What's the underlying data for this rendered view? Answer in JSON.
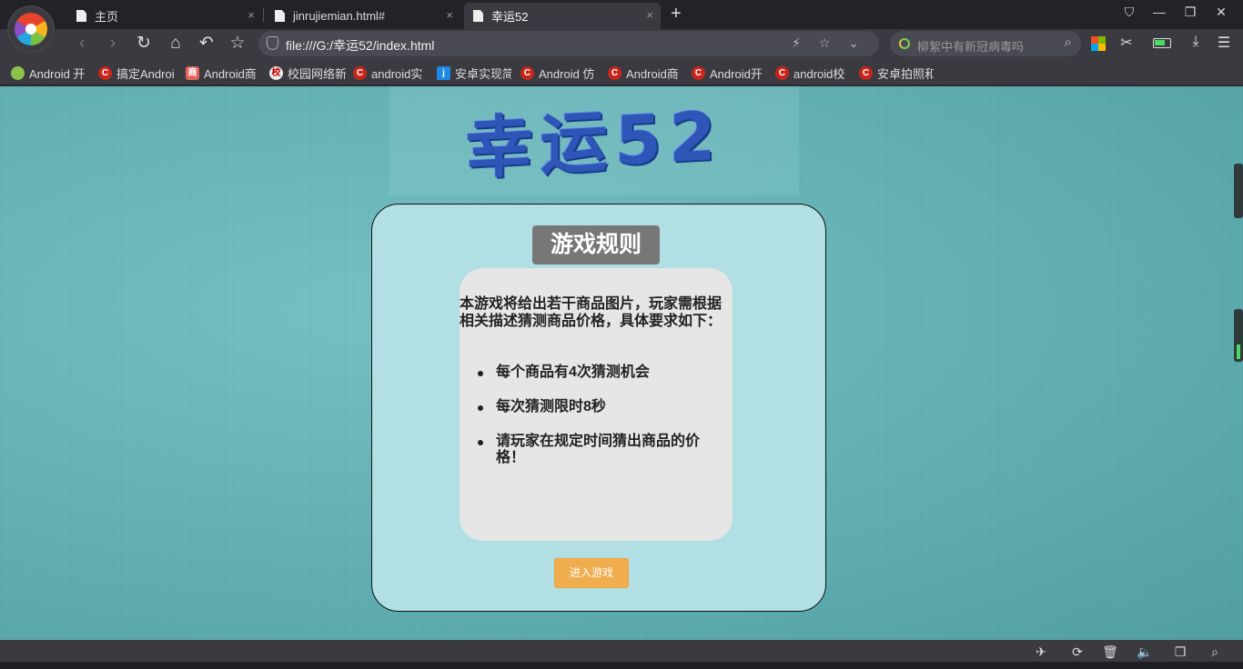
{
  "browser": {
    "tabs": [
      {
        "title": "主页",
        "close": "×"
      },
      {
        "title": "jinrujiemian.html#",
        "close": "×"
      },
      {
        "title": "幸运52",
        "close": "×"
      }
    ],
    "new_tab": "+",
    "window_controls": {
      "skin": "⛉",
      "minimize": "—",
      "restore": "❐",
      "close": "✕"
    },
    "nav": {
      "back": "‹",
      "forward": "›",
      "reload": "↻",
      "home": "⌂",
      "undo": "↶",
      "favorite": "☆"
    },
    "address": "file:///G:/幸运52/index.html",
    "address_icons": "⚡ ☆ ⌄",
    "search_placeholder": "柳絮中有新冠病毒吗",
    "toolbar_icons": {
      "scissors": "✂",
      "download": "⤓",
      "menu": "☰"
    },
    "bookmarks": [
      {
        "label": "Android 开",
        "icon": "android-icon"
      },
      {
        "label": "搞定Androi",
        "icon": "csdn-icon"
      },
      {
        "label": "Android商",
        "icon": "shang-icon"
      },
      {
        "label": "校园网络新",
        "icon": "school-icon"
      },
      {
        "label": "android实",
        "icon": "csdn-icon"
      },
      {
        "label": "安卓实现简",
        "icon": "jb-icon"
      },
      {
        "label": "Android 仿",
        "icon": "csdn-icon"
      },
      {
        "label": "Android商",
        "icon": "csdn-icon"
      },
      {
        "label": "Android开",
        "icon": "csdn-icon"
      },
      {
        "label": "android校",
        "icon": "csdn-icon"
      },
      {
        "label": "安卓拍照和",
        "icon": "csdn-icon"
      }
    ],
    "bookmark_glyphs": {
      "csdn": "C",
      "shang": "商",
      "jb": "j",
      "school": "校"
    },
    "status_icons": [
      "✈",
      "⟳",
      "🗑",
      "🔈",
      "❐",
      "⌕"
    ]
  },
  "page": {
    "banner": "幸运52",
    "rules_title": "游戏规则",
    "rules_intro": "本游戏将给出若干商品图片，玩家需根据相关描述猜测商品价格，具体要求如下：",
    "rules": [
      "每个商品有4次猜测机会",
      "每次猜测限时8秒",
      "请玩家在规定时间猜出商品的价格！"
    ],
    "enter_button": "进入游戏"
  },
  "colors": {
    "accent_button": "#f0ad4e",
    "card_bg": "#b1dfe3",
    "rules_box_bg": "#e6e6e6",
    "title_bg": "#777777"
  }
}
